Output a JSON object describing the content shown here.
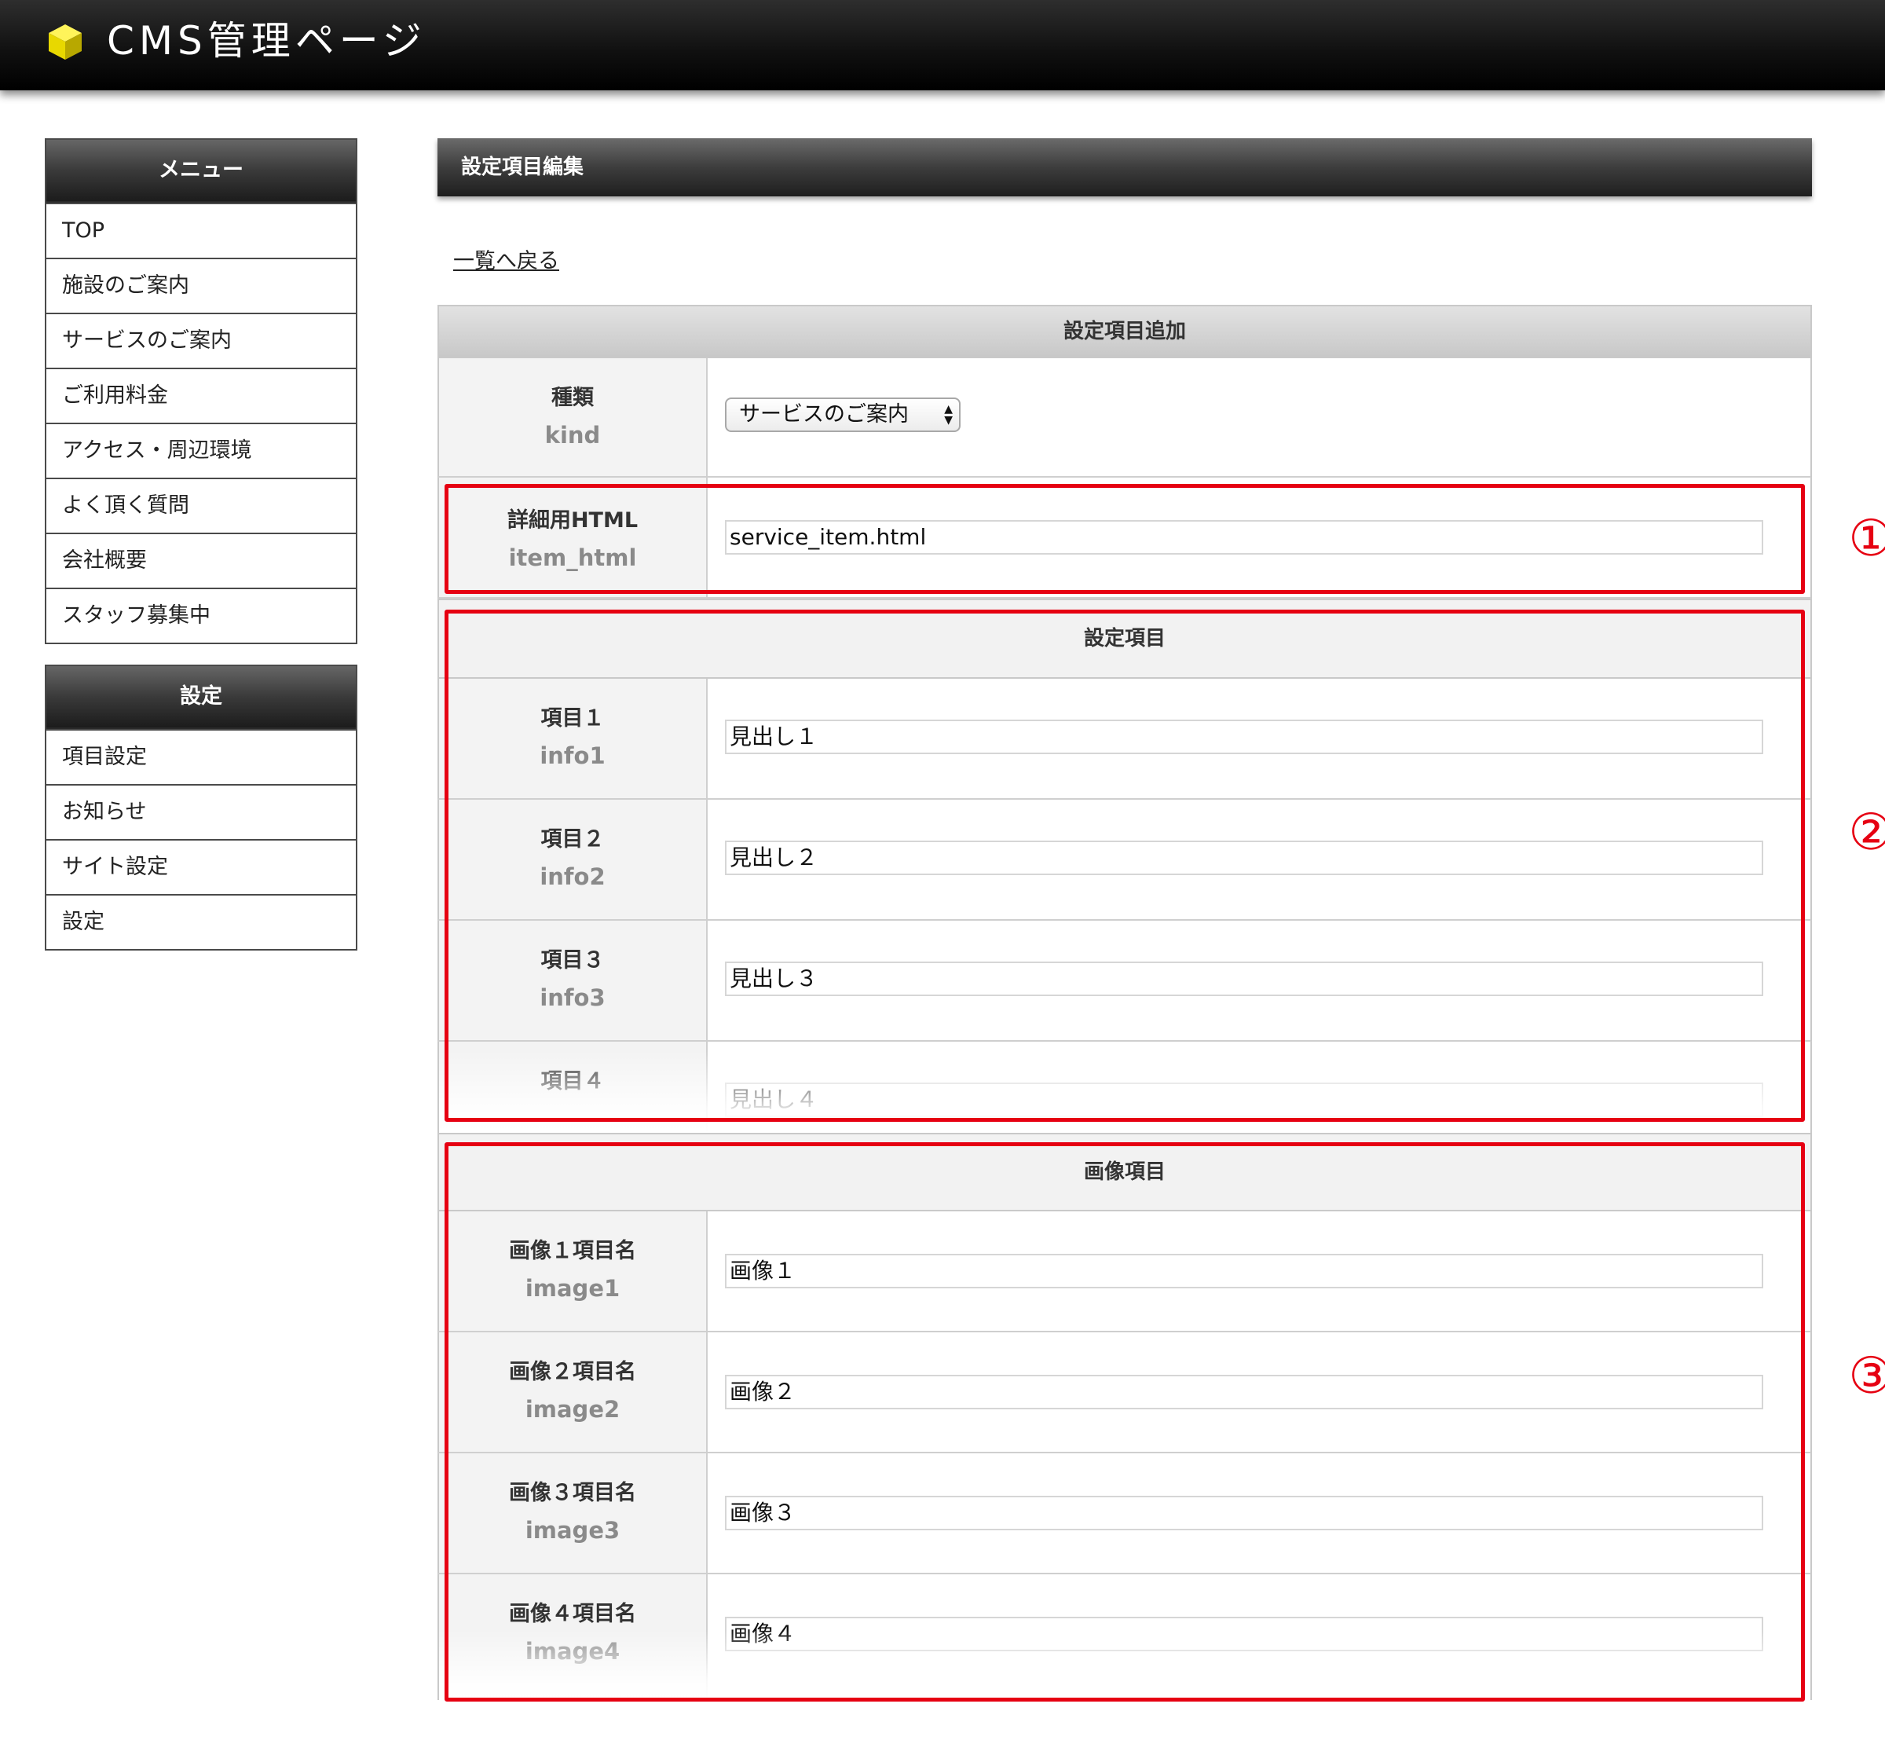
{
  "header": {
    "title": "CMS管理ページ",
    "logo_icon": "yellow-cube-icon"
  },
  "sidebar": {
    "menu": {
      "heading": "メニュー",
      "items": [
        {
          "label": "TOP"
        },
        {
          "label": "施設のご案内"
        },
        {
          "label": "サービスのご案内"
        },
        {
          "label": "ご利用料金"
        },
        {
          "label": "アクセス・周辺環境"
        },
        {
          "label": "よく頂く質問"
        },
        {
          "label": "会社概要"
        },
        {
          "label": "スタッフ募集中"
        }
      ]
    },
    "settings": {
      "heading": "設定",
      "items": [
        {
          "label": "項目設定"
        },
        {
          "label": "お知らせ"
        },
        {
          "label": "サイト設定"
        },
        {
          "label": "設定"
        }
      ]
    }
  },
  "main": {
    "page_title": "設定項目編集",
    "back_link": "一覧へ戻る",
    "form_title": "設定項目追加",
    "kind": {
      "label": "種類",
      "key": "kind",
      "value": "サービスのご案内"
    },
    "item_html": {
      "label": "詳細用HTML",
      "key": "item_html",
      "value": "service_item.html"
    },
    "settings_section": {
      "title": "設定項目",
      "rows": [
        {
          "label": "項目１",
          "key": "info1",
          "value": "見出し１"
        },
        {
          "label": "項目２",
          "key": "info2",
          "value": "見出し２"
        },
        {
          "label": "項目３",
          "key": "info3",
          "value": "見出し３"
        },
        {
          "label": "項目４",
          "key": "",
          "value": "見出し４"
        }
      ]
    },
    "image_section": {
      "title": "画像項目",
      "rows": [
        {
          "label": "画像１項目名",
          "key": "image1",
          "value": "画像１"
        },
        {
          "label": "画像２項目名",
          "key": "image2",
          "value": "画像２"
        },
        {
          "label": "画像３項目名",
          "key": "image3",
          "value": "画像３"
        },
        {
          "label": "画像４項目名",
          "key": "image4",
          "value": "画像４"
        }
      ]
    }
  },
  "annotations": {
    "marker_1": "①",
    "marker_2": "②",
    "marker_3": "③",
    "color": "#e60012"
  },
  "colors": {
    "header_bg": "#111111",
    "logo_yellow": "#f2e600",
    "label_bg": "#f3f3f3",
    "section_bg": "#d6d6d6"
  }
}
